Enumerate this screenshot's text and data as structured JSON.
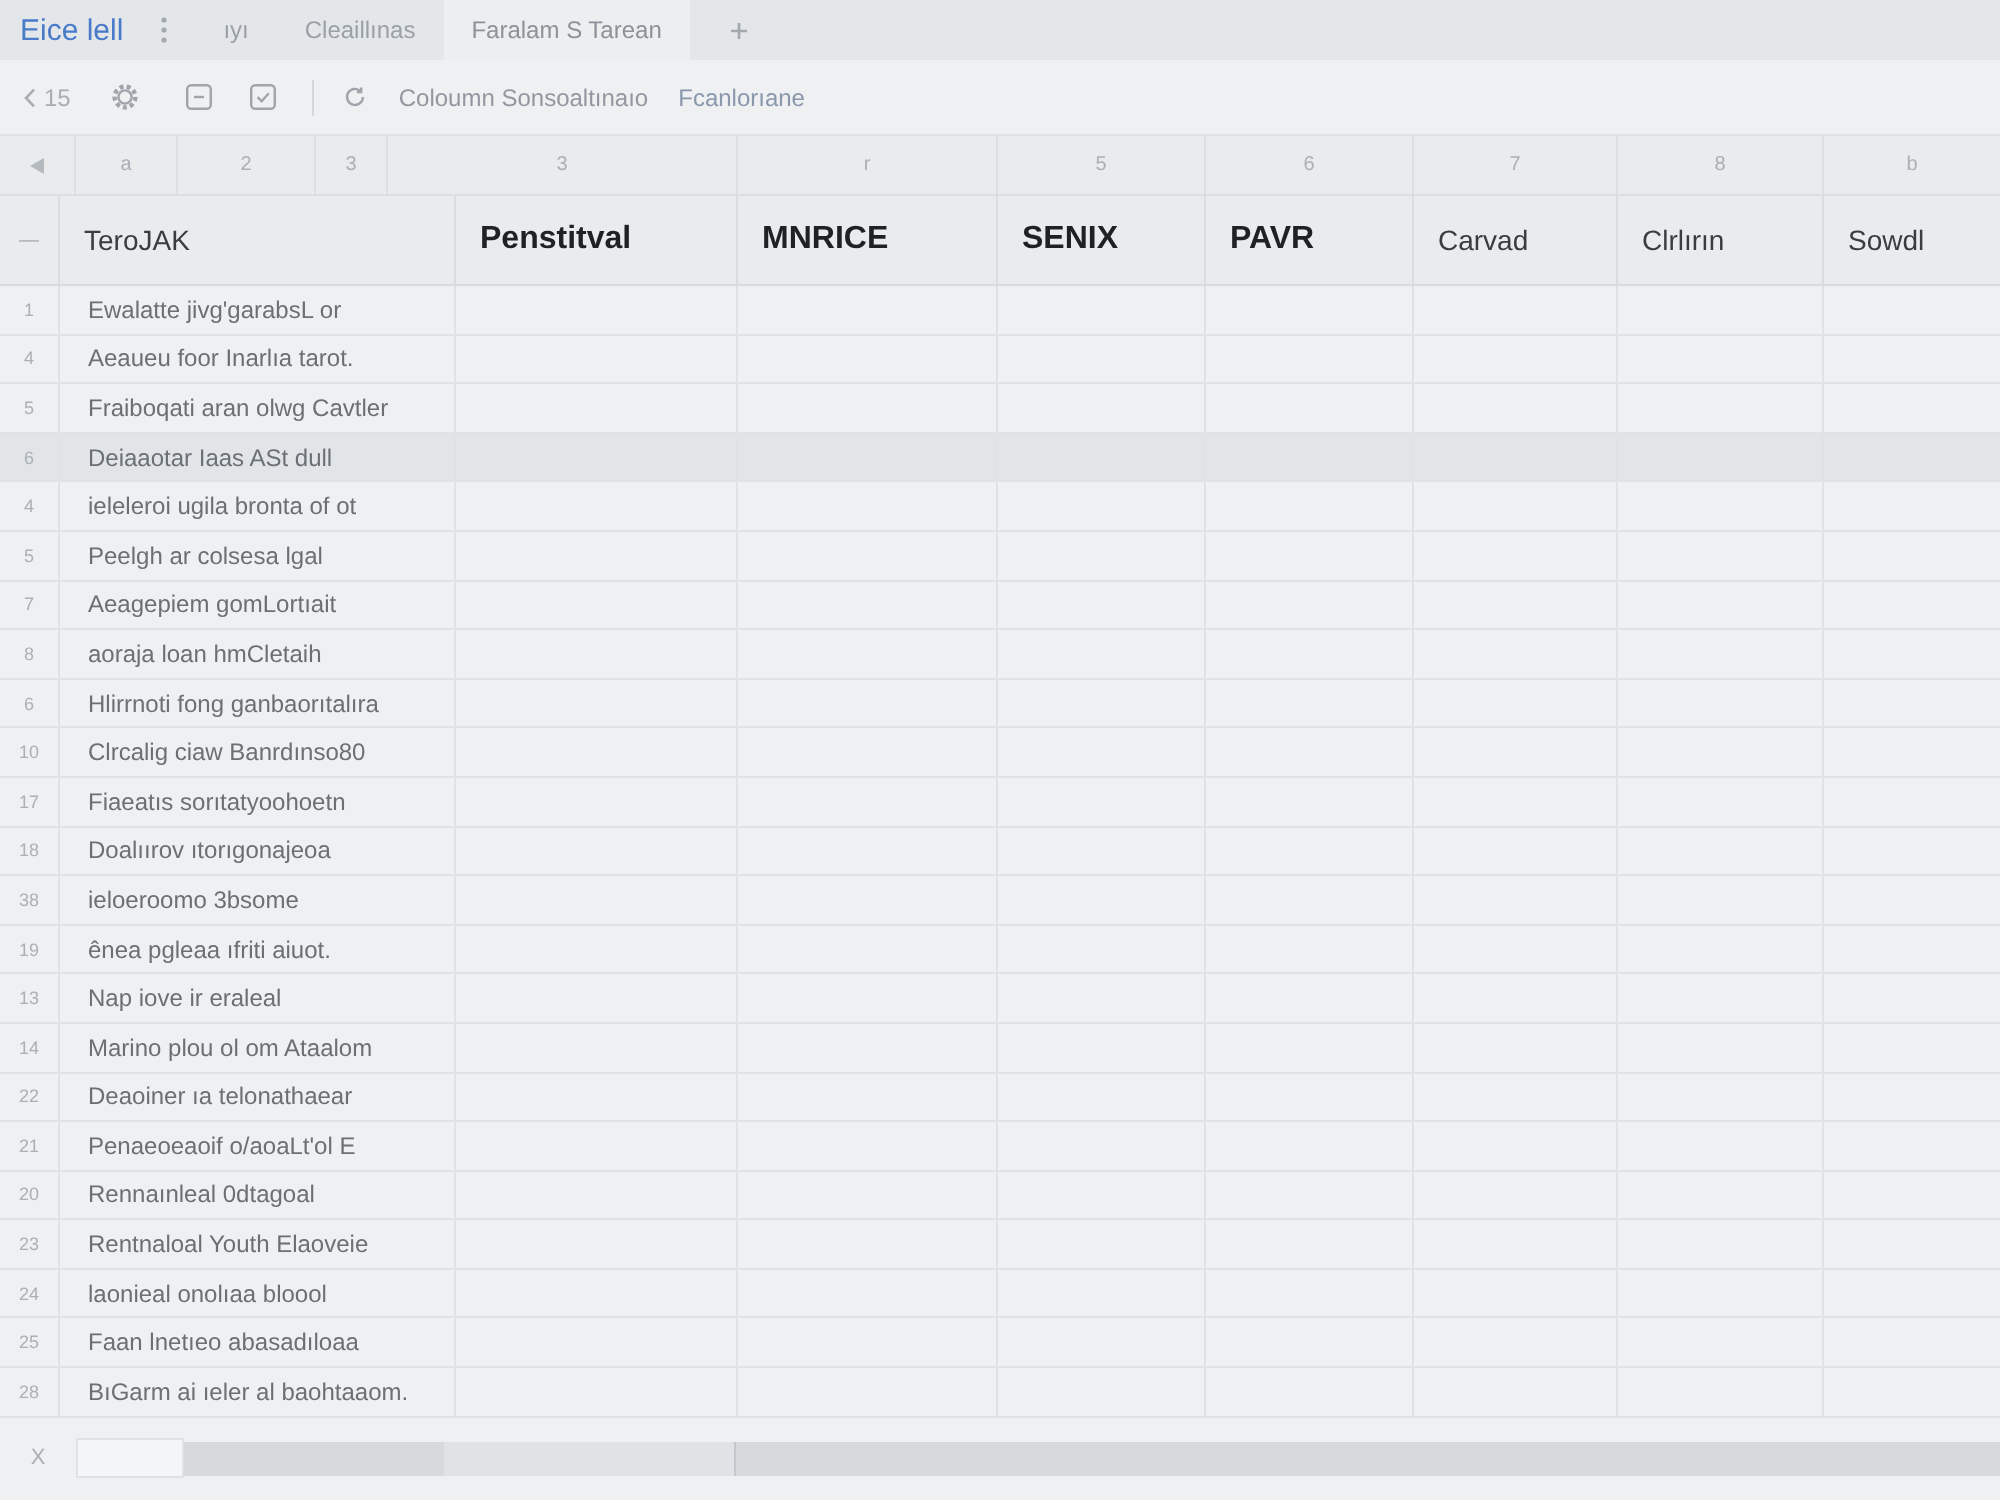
{
  "header": {
    "title": "Eice lell",
    "tabs": [
      {
        "label": "ıyı",
        "selected": false
      },
      {
        "label": "Cleaillınas",
        "selected": false
      },
      {
        "label": "Faralam S Tarean",
        "selected": true
      }
    ]
  },
  "toolbar": {
    "undo_count": "15",
    "actions": [
      "Coloumn Sonsoaltınaıo",
      "Fcanlorıane"
    ]
  },
  "column_letters": [
    "a",
    "2",
    "3",
    "3",
    "r",
    "5",
    "6",
    "7",
    "8",
    "b"
  ],
  "table": {
    "corner": "—",
    "columns": [
      {
        "label": "TeroJAK",
        "bold": false
      },
      {
        "label": "Penstitval",
        "bold": true
      },
      {
        "label": "MNRICE",
        "bold": true
      },
      {
        "label": "SENIX",
        "bold": true
      },
      {
        "label": "PAVR",
        "bold": true
      },
      {
        "label": "Carvad",
        "bold": false
      },
      {
        "label": "Clrlırın",
        "bold": false
      },
      {
        "label": "Sowdl",
        "bold": false
      }
    ],
    "rows": [
      {
        "number": "1",
        "label": "Ewalatte jivg'garabsL or",
        "selected": false
      },
      {
        "number": "4",
        "label": "Aeaueu foor Inarlıa tarot.",
        "selected": false
      },
      {
        "number": "5",
        "label": "Fraiboqati aran olwg Cavtler",
        "selected": false
      },
      {
        "number": "6",
        "label": "Deiaaotar Iaas ASt dull",
        "selected": true
      },
      {
        "number": "4",
        "label": "ieleleroi ugila bronta of ot",
        "selected": false
      },
      {
        "number": "5",
        "label": "Peelgh ar colsesa lgal",
        "selected": false
      },
      {
        "number": "7",
        "label": "Aeagepiem gomLortıait",
        "selected": false
      },
      {
        "number": "8",
        "label": "aoraja loan hmCletaih",
        "selected": false
      },
      {
        "number": "6",
        "label": "Hlirrnoti fong ganbaorıtalıra",
        "selected": false
      },
      {
        "number": "10",
        "label": "Clrcalig ciaw Banrdınso80",
        "selected": false
      },
      {
        "number": "17",
        "label": "Fiaeatıs sorıtatyoohoetn",
        "selected": false
      },
      {
        "number": "18",
        "label": "Doalıırov ıtorıgonajeoa",
        "selected": false
      },
      {
        "number": "38",
        "label": "ieloeroomo 3bsome",
        "selected": false
      },
      {
        "number": "19",
        "label": "ênea pgleaa ıfriti aiuot.",
        "selected": false
      },
      {
        "number": "13",
        "label": "Nap iove ir eraleal",
        "selected": false
      },
      {
        "number": "14",
        "label": "Marino plou ol om Ataalom",
        "selected": false
      },
      {
        "number": "22",
        "label": "Deaoiner ıa telonathaear",
        "selected": false
      },
      {
        "number": "21",
        "label": "Penaeoeaoif o/aoaLt'ol E",
        "selected": false
      },
      {
        "number": "20",
        "label": "Rennaınleal 0dtagoal",
        "selected": false
      },
      {
        "number": "23",
        "label": "Rentnaloal Youth Elaoveie",
        "selected": false
      },
      {
        "number": "24",
        "label": "laonieal onolıaa bloool",
        "selected": false
      },
      {
        "number": "25",
        "label": "Faan lnetıeo abasadıloaa",
        "selected": false
      },
      {
        "number": "28",
        "label": "BıGarm ai ıeler al baohtaaom.",
        "selected": false
      }
    ]
  },
  "footer": {
    "symbol": "X"
  }
}
